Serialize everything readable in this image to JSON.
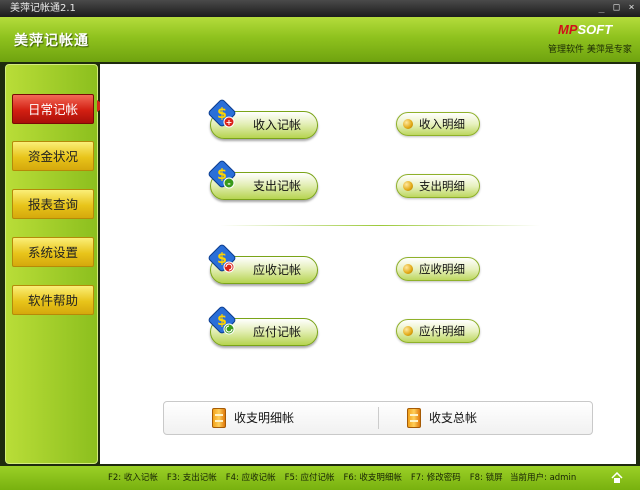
{
  "window": {
    "title": "美萍记帐通2.1",
    "controls": [
      "_",
      "□",
      "×"
    ]
  },
  "header": {
    "app_title": "美萍记帐通",
    "logo_mp": "MP",
    "logo_soft": "SOFT",
    "slogan": "管理软件 美萍是专家"
  },
  "sidebar": {
    "items": [
      {
        "label": "日常记帐",
        "active": true
      },
      {
        "label": "资金状况",
        "active": false
      },
      {
        "label": "报表查询",
        "active": false
      },
      {
        "label": "系统设置",
        "active": false
      },
      {
        "label": "软件帮助",
        "active": false
      }
    ]
  },
  "main": {
    "actions": [
      {
        "label": "收入记帐",
        "badge": "+"
      },
      {
        "label": "支出记帐",
        "badge": "-"
      },
      {
        "label": "应收记帐",
        "badge": ""
      },
      {
        "label": "应付记帐",
        "badge": ""
      }
    ],
    "details": [
      {
        "label": "收入明细"
      },
      {
        "label": "支出明细"
      },
      {
        "label": "应收明细"
      },
      {
        "label": "应付明细"
      }
    ],
    "bottom": [
      {
        "label": "收支明细帐"
      },
      {
        "label": "收支总帐"
      }
    ]
  },
  "statusbar": {
    "shortcuts": [
      "F2: 收入记帐",
      "F3: 支出记帐",
      "F4: 应收记帐",
      "F5: 应付记帐",
      "F6: 收支明细帐",
      "F7: 修改密码",
      "F8: 锁屏"
    ],
    "current_user_label": "当前用户:",
    "current_user": "admin"
  },
  "colors": {
    "header_green": "#8fc21e",
    "nav_yellow": "#e8c41a",
    "nav_active_red": "#d21f12",
    "dollar_blue": "#2a6fd8"
  }
}
